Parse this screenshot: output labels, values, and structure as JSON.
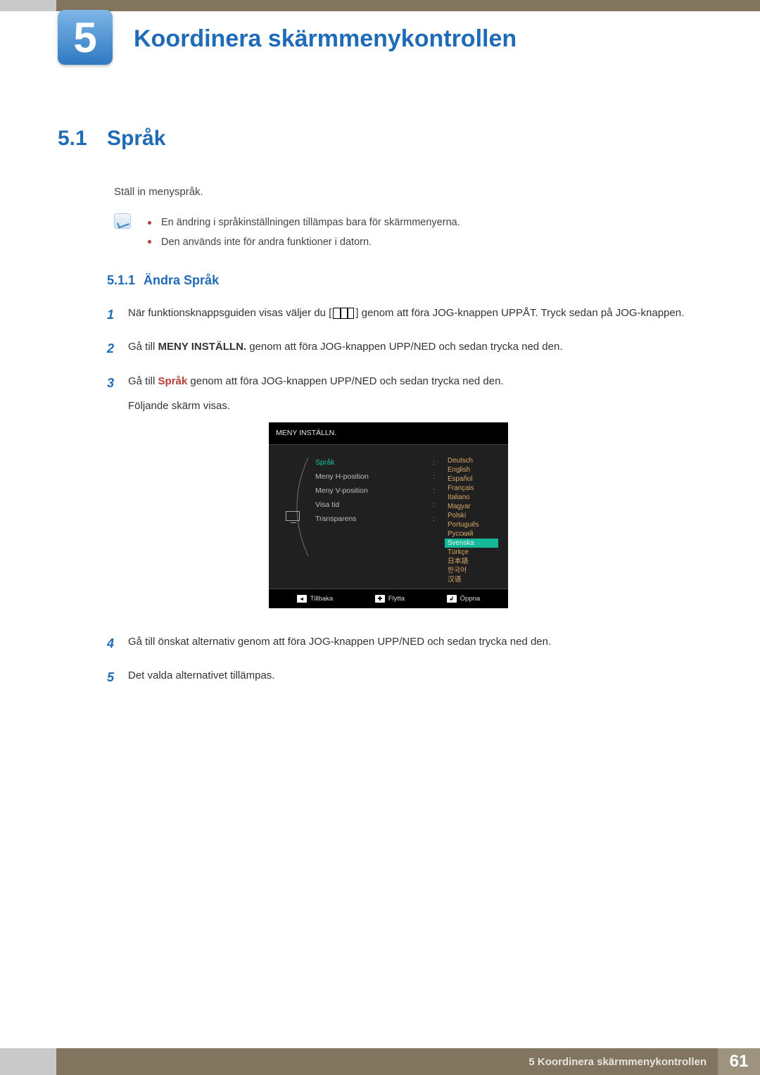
{
  "chapter": {
    "number": "5",
    "title": "Koordinera skärmmenykontrollen"
  },
  "section": {
    "number": "5.1",
    "title": "Språk",
    "intro": "Ställ in menyspråk."
  },
  "notes": [
    "En ändring i språkinställningen tillämpas bara för skärmmenyerna.",
    "Den används inte för andra funktioner i datorn."
  ],
  "subsection": {
    "number": "5.1.1",
    "title": "Ändra Språk"
  },
  "steps": {
    "s1a": "När funktionsknappsguiden visas väljer du [",
    "s1b": "] genom att föra JOG-knappen UPPÅT. Tryck sedan på JOG-knappen.",
    "s2a": "Gå till ",
    "s2bold": "MENY INSTÄLLN.",
    "s2b": " genom att föra JOG-knappen UPP/NED och sedan trycka ned den.",
    "s3a": "Gå till ",
    "s3bold": "Språk",
    "s3b": " genom att föra JOG-knappen UPP/NED och sedan trycka ned den.",
    "s3c": "Följande skärm visas.",
    "s4": "Gå till önskat alternativ genom att föra JOG-knappen UPP/NED och sedan trycka ned den.",
    "s5": "Det valda alternativet tillämpas."
  },
  "osd": {
    "title": "MENY INSTÄLLN.",
    "items": [
      {
        "label": "Språk",
        "selected": true
      },
      {
        "label": "Meny H-position",
        "selected": false
      },
      {
        "label": "Meny V-position",
        "selected": false
      },
      {
        "label": "Visa tid",
        "selected": false
      },
      {
        "label": "Transparens",
        "selected": false
      }
    ],
    "languages": [
      {
        "name": "Deutsch"
      },
      {
        "name": "English"
      },
      {
        "name": "Español"
      },
      {
        "name": "Français"
      },
      {
        "name": "Italiano"
      },
      {
        "name": "Magyar"
      },
      {
        "name": "Polski"
      },
      {
        "name": "Português"
      },
      {
        "name": "Русский"
      },
      {
        "name": "Svenska",
        "highlight": true
      },
      {
        "name": "Türkçe"
      },
      {
        "name": "日本語"
      },
      {
        "name": "한국어"
      },
      {
        "name": "汉语"
      }
    ],
    "footer": {
      "back": "Tillbaka",
      "move": "Flytta",
      "open": "Öppna"
    }
  },
  "footer": {
    "text": "5 Koordinera skärmmenykontrollen",
    "page": "61"
  }
}
